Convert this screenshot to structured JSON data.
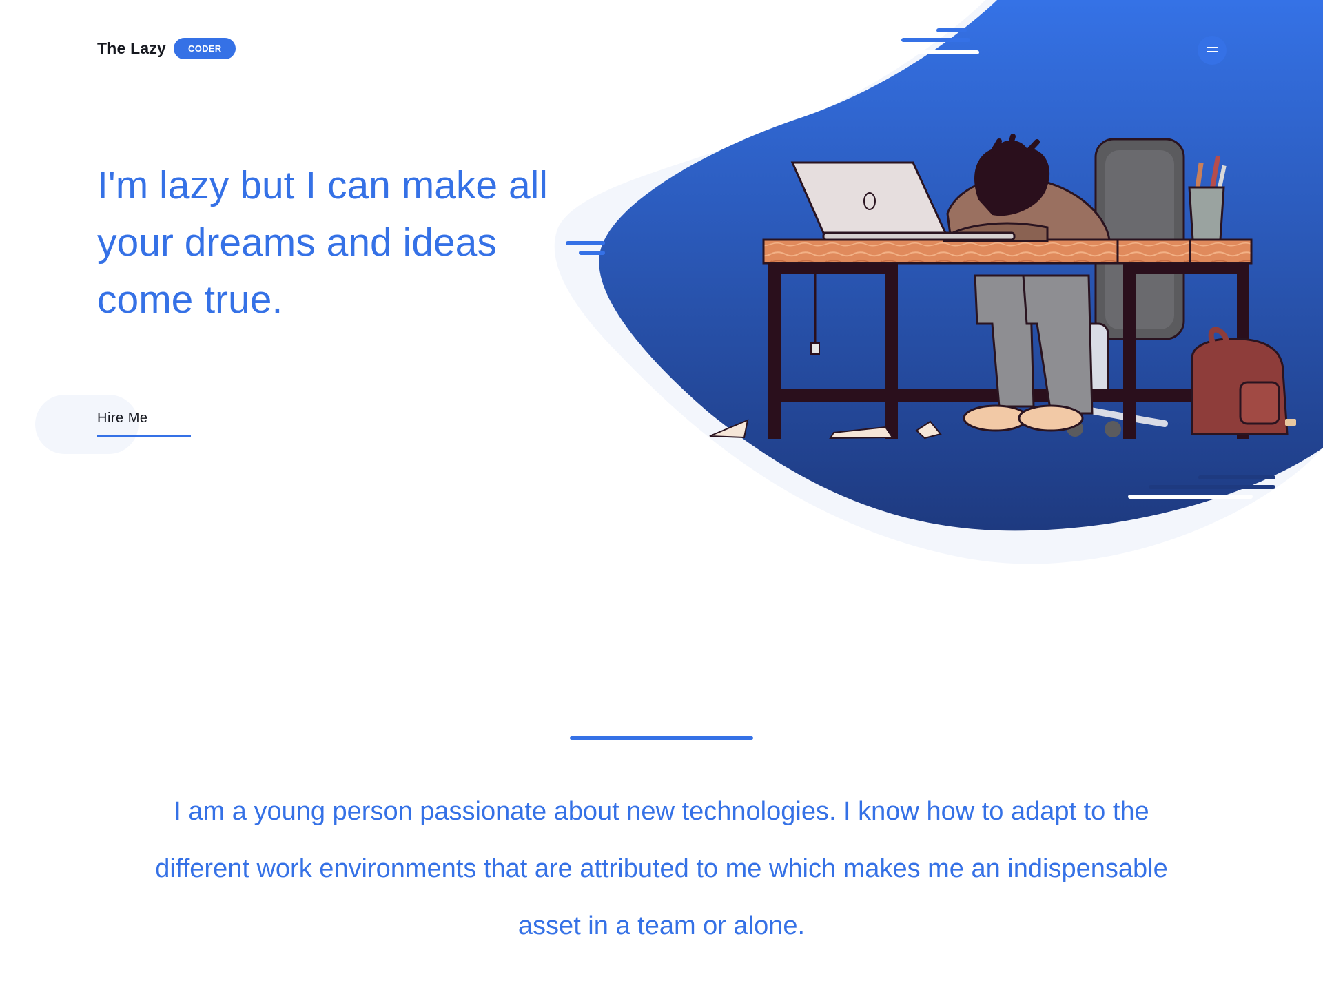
{
  "header": {
    "brand_name": "The Lazy",
    "brand_badge": "CODER",
    "menu_label": "Menu"
  },
  "hero": {
    "headline": "I'm lazy but I can make all your dreams and ideas come true.",
    "cta_label": "Hire Me"
  },
  "about": {
    "text": "I am a young person passionate about new technologies. I know how to adapt to the different work environments that are attributed to me which makes me an indispensable asset in a team or alone."
  },
  "illustration": {
    "subject": "person asleep at desk with laptop",
    "icons": [
      "laptop-icon",
      "chair-icon",
      "backpack-icon",
      "pencil-cup-icon"
    ]
  },
  "colors": {
    "accent": "#3571e6",
    "blob_top": "#3572e6",
    "blob_bottom": "#1e3a80",
    "soft_background": "#f3f6fc",
    "text_dark": "#16181f"
  }
}
